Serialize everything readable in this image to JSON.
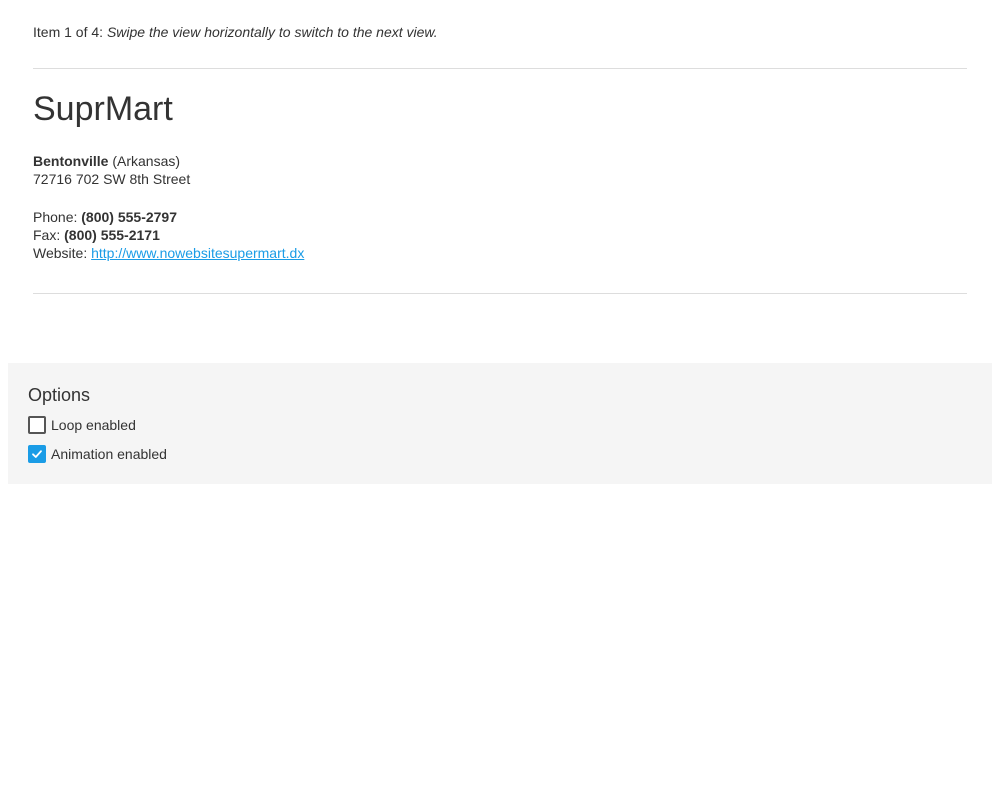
{
  "gallery": {
    "item_prefix": "Item 1 of 4:",
    "item_hint": "Swipe the view horizontally to switch to the next view.",
    "store": {
      "name": "SuprMart",
      "city": "Bentonville",
      "state": "(Arkansas)",
      "address_line": "72716 702 SW 8th Street",
      "phone_label": "Phone:",
      "phone": "(800) 555-2797",
      "fax_label": "Fax:",
      "fax": "(800) 555-2171",
      "website_label": "Website:",
      "website": "http://www.nowebsitesupermart.dx"
    }
  },
  "options": {
    "title": "Options",
    "loop": {
      "label": "Loop enabled",
      "checked": false
    },
    "animation": {
      "label": "Animation enabled",
      "checked": true
    }
  },
  "colors": {
    "accent": "#1a9ce6",
    "panel_bg": "#f5f5f5",
    "divider": "#dddddd",
    "text": "#333333"
  },
  "icons": {
    "checkmark": "check-icon"
  }
}
